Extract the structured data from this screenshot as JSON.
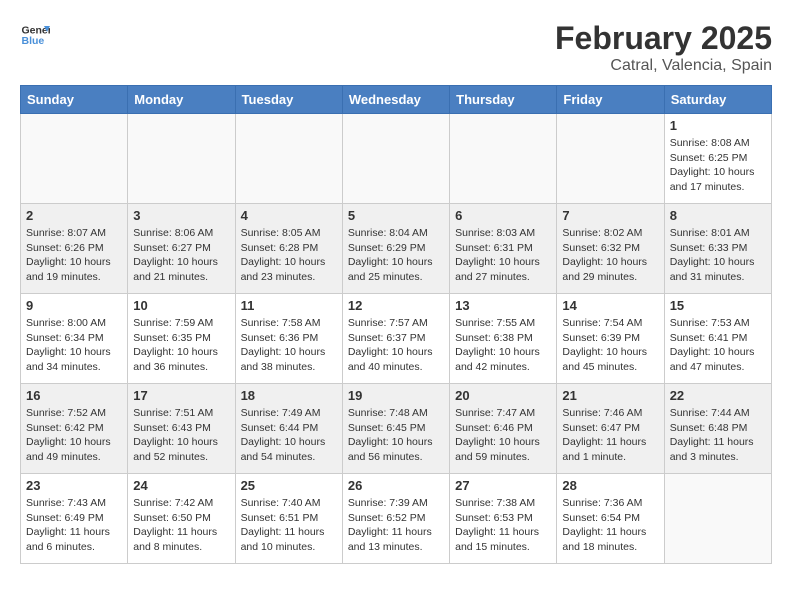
{
  "header": {
    "logo_general": "General",
    "logo_blue": "Blue",
    "main_title": "February 2025",
    "subtitle": "Catral, Valencia, Spain"
  },
  "calendar": {
    "days_of_week": [
      "Sunday",
      "Monday",
      "Tuesday",
      "Wednesday",
      "Thursday",
      "Friday",
      "Saturday"
    ],
    "weeks": [
      {
        "shaded": false,
        "days": [
          {
            "number": "",
            "info": ""
          },
          {
            "number": "",
            "info": ""
          },
          {
            "number": "",
            "info": ""
          },
          {
            "number": "",
            "info": ""
          },
          {
            "number": "",
            "info": ""
          },
          {
            "number": "",
            "info": ""
          },
          {
            "number": "1",
            "info": "Sunrise: 8:08 AM\nSunset: 6:25 PM\nDaylight: 10 hours and 17 minutes."
          }
        ]
      },
      {
        "shaded": true,
        "days": [
          {
            "number": "2",
            "info": "Sunrise: 8:07 AM\nSunset: 6:26 PM\nDaylight: 10 hours and 19 minutes."
          },
          {
            "number": "3",
            "info": "Sunrise: 8:06 AM\nSunset: 6:27 PM\nDaylight: 10 hours and 21 minutes."
          },
          {
            "number": "4",
            "info": "Sunrise: 8:05 AM\nSunset: 6:28 PM\nDaylight: 10 hours and 23 minutes."
          },
          {
            "number": "5",
            "info": "Sunrise: 8:04 AM\nSunset: 6:29 PM\nDaylight: 10 hours and 25 minutes."
          },
          {
            "number": "6",
            "info": "Sunrise: 8:03 AM\nSunset: 6:31 PM\nDaylight: 10 hours and 27 minutes."
          },
          {
            "number": "7",
            "info": "Sunrise: 8:02 AM\nSunset: 6:32 PM\nDaylight: 10 hours and 29 minutes."
          },
          {
            "number": "8",
            "info": "Sunrise: 8:01 AM\nSunset: 6:33 PM\nDaylight: 10 hours and 31 minutes."
          }
        ]
      },
      {
        "shaded": false,
        "days": [
          {
            "number": "9",
            "info": "Sunrise: 8:00 AM\nSunset: 6:34 PM\nDaylight: 10 hours and 34 minutes."
          },
          {
            "number": "10",
            "info": "Sunrise: 7:59 AM\nSunset: 6:35 PM\nDaylight: 10 hours and 36 minutes."
          },
          {
            "number": "11",
            "info": "Sunrise: 7:58 AM\nSunset: 6:36 PM\nDaylight: 10 hours and 38 minutes."
          },
          {
            "number": "12",
            "info": "Sunrise: 7:57 AM\nSunset: 6:37 PM\nDaylight: 10 hours and 40 minutes."
          },
          {
            "number": "13",
            "info": "Sunrise: 7:55 AM\nSunset: 6:38 PM\nDaylight: 10 hours and 42 minutes."
          },
          {
            "number": "14",
            "info": "Sunrise: 7:54 AM\nSunset: 6:39 PM\nDaylight: 10 hours and 45 minutes."
          },
          {
            "number": "15",
            "info": "Sunrise: 7:53 AM\nSunset: 6:41 PM\nDaylight: 10 hours and 47 minutes."
          }
        ]
      },
      {
        "shaded": true,
        "days": [
          {
            "number": "16",
            "info": "Sunrise: 7:52 AM\nSunset: 6:42 PM\nDaylight: 10 hours and 49 minutes."
          },
          {
            "number": "17",
            "info": "Sunrise: 7:51 AM\nSunset: 6:43 PM\nDaylight: 10 hours and 52 minutes."
          },
          {
            "number": "18",
            "info": "Sunrise: 7:49 AM\nSunset: 6:44 PM\nDaylight: 10 hours and 54 minutes."
          },
          {
            "number": "19",
            "info": "Sunrise: 7:48 AM\nSunset: 6:45 PM\nDaylight: 10 hours and 56 minutes."
          },
          {
            "number": "20",
            "info": "Sunrise: 7:47 AM\nSunset: 6:46 PM\nDaylight: 10 hours and 59 minutes."
          },
          {
            "number": "21",
            "info": "Sunrise: 7:46 AM\nSunset: 6:47 PM\nDaylight: 11 hours and 1 minute."
          },
          {
            "number": "22",
            "info": "Sunrise: 7:44 AM\nSunset: 6:48 PM\nDaylight: 11 hours and 3 minutes."
          }
        ]
      },
      {
        "shaded": false,
        "days": [
          {
            "number": "23",
            "info": "Sunrise: 7:43 AM\nSunset: 6:49 PM\nDaylight: 11 hours and 6 minutes."
          },
          {
            "number": "24",
            "info": "Sunrise: 7:42 AM\nSunset: 6:50 PM\nDaylight: 11 hours and 8 minutes."
          },
          {
            "number": "25",
            "info": "Sunrise: 7:40 AM\nSunset: 6:51 PM\nDaylight: 11 hours and 10 minutes."
          },
          {
            "number": "26",
            "info": "Sunrise: 7:39 AM\nSunset: 6:52 PM\nDaylight: 11 hours and 13 minutes."
          },
          {
            "number": "27",
            "info": "Sunrise: 7:38 AM\nSunset: 6:53 PM\nDaylight: 11 hours and 15 minutes."
          },
          {
            "number": "28",
            "info": "Sunrise: 7:36 AM\nSunset: 6:54 PM\nDaylight: 11 hours and 18 minutes."
          },
          {
            "number": "",
            "info": ""
          }
        ]
      }
    ]
  }
}
